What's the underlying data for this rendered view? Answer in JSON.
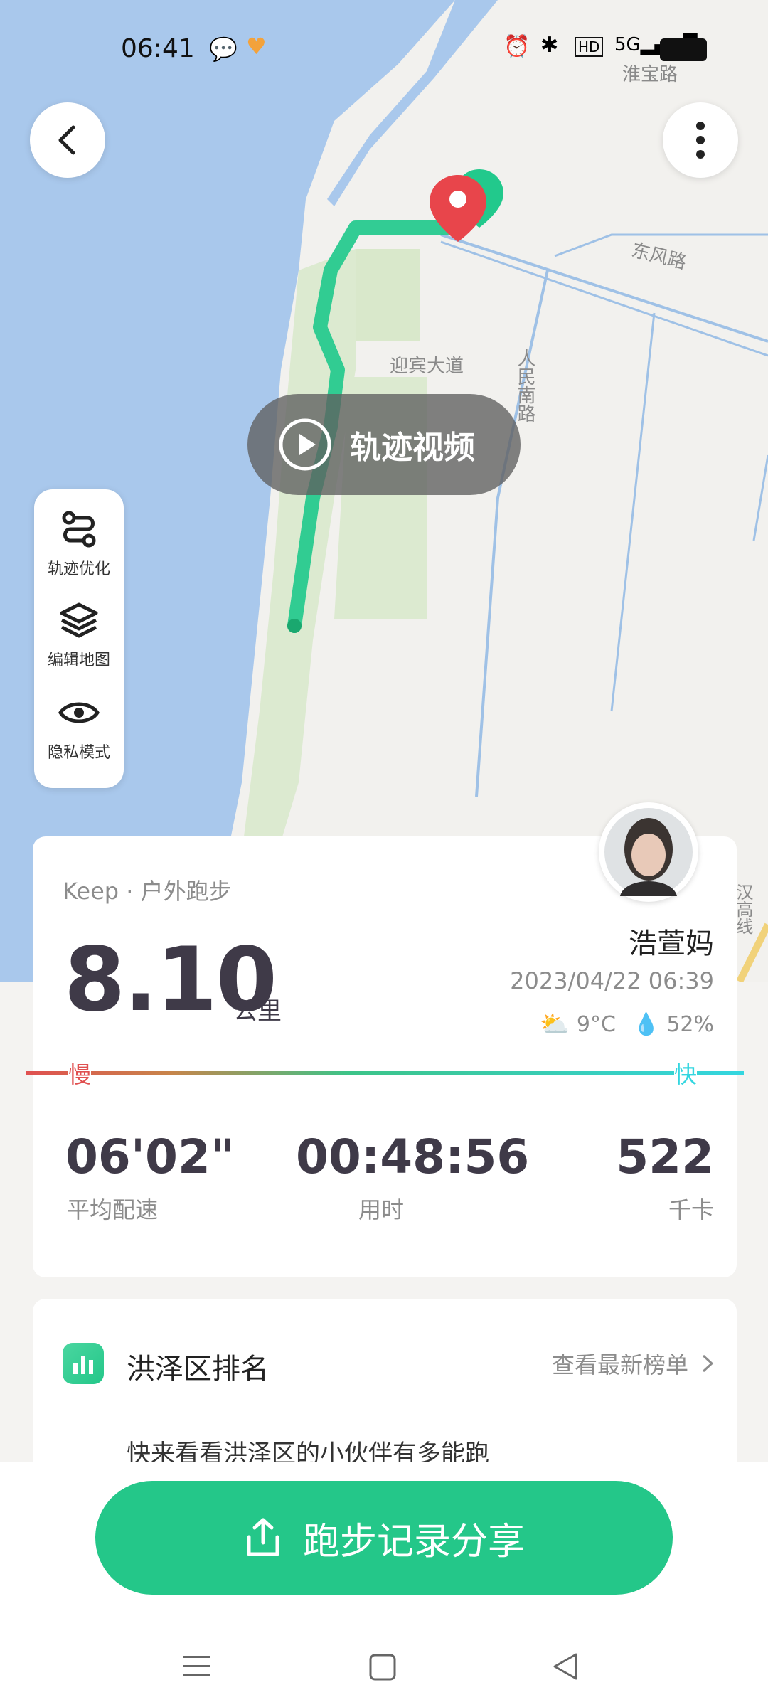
{
  "status_bar": {
    "time": "06:41"
  },
  "map": {
    "road_labels": [
      "淮宝路",
      "东风路",
      "人民南路",
      "迎宾大道",
      "汉高线"
    ],
    "video_button_label": "轨迹视频"
  },
  "map_tools": [
    {
      "label": "轨迹优化",
      "icon": "route-icon"
    },
    {
      "label": "编辑地图",
      "icon": "layers-icon"
    },
    {
      "label": "隐私模式",
      "icon": "eye-icon"
    }
  ],
  "summary": {
    "source": "Keep · 户外跑步",
    "distance": "8.10",
    "distance_unit": "公里",
    "username": "浩萱妈",
    "datetime": "2023/04/22 06:39",
    "temperature": "9°C",
    "humidity": "52%",
    "slow_label": "慢",
    "fast_label": "快",
    "stats": [
      {
        "value": "06'02\"",
        "label": "平均配速"
      },
      {
        "value": "00:48:56",
        "label": "用时"
      },
      {
        "value": "522",
        "label": "千卡"
      }
    ]
  },
  "ranking": {
    "title": "洪泽区排名",
    "link": "查看最新榜单",
    "desc": "快来看看洪泽区的小伙伴有多能跑"
  },
  "share_button": {
    "label": "跑步记录分享"
  },
  "colors": {
    "accent": "#24c789",
    "route": "#22c98c",
    "slow": "#e05050",
    "fast": "#34d6e0"
  }
}
